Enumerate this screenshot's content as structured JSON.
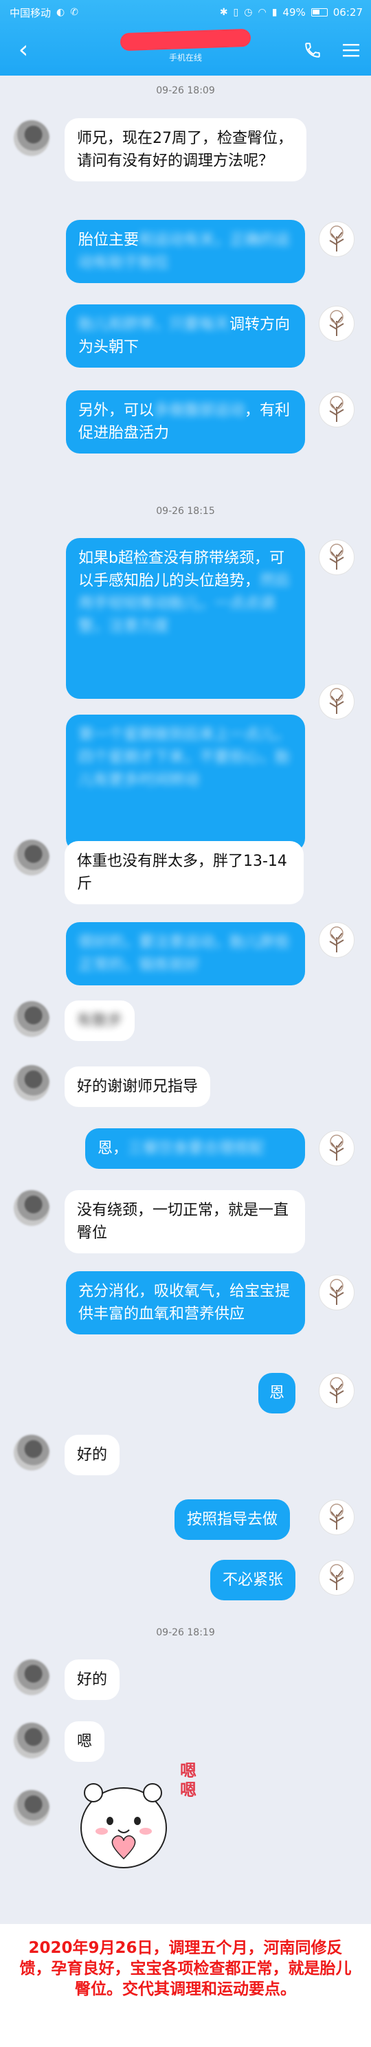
{
  "status_bar": {
    "carrier": "中国移动",
    "battery": "49%",
    "time": "06:27",
    "icons": [
      "bluetooth-icon",
      "vibrate-icon",
      "alarm-icon",
      "wifi-icon",
      "signal-icon",
      "battery-icon"
    ]
  },
  "header": {
    "back_glyph": "‹",
    "subtitle": "手机在线",
    "accent_color": "#1ea7f5"
  },
  "timestamps": [
    "09-26 18:09",
    "09-26 18:15",
    "09-26 18:19"
  ],
  "messages": [
    {
      "side": "left",
      "text": "师兄，现在27周了，检查臀位，请问有没有好的调理方法呢？"
    },
    {
      "side": "right",
      "visible": "胎位主要",
      "blurred": "和运动有关，正确的运动有助于胎位"
    },
    {
      "side": "right",
      "blurred": "胎儿和脐带，只要每天",
      "visible": "调转方向为头朝下"
    },
    {
      "side": "right",
      "visible": "另外，可以",
      "blurred": "多做腹部运动",
      "visible2": "，有利促进胎盘活力"
    },
    {
      "side": "right",
      "visible": "如果b超检查没有脐带绕颈，可以手感知胎儿的头位趋势，",
      "blurred": "然后用手轻轻推动胎儿，一点点调整，注意力度"
    },
    {
      "side": "right",
      "blurred": "第一个星期做到后来上一点儿，四个星期才下来，不要担心，胎儿有更多时间转动"
    },
    {
      "side": "left",
      "text": "体重也没有胖太多，胖了13-14斤"
    },
    {
      "side": "right",
      "blurred": "很好的，要注意运动，胎儿胖些正常的，锻炼就好"
    },
    {
      "side": "left",
      "blurred": "有散步"
    },
    {
      "side": "left",
      "text": "好的谢谢师兄指导"
    },
    {
      "side": "right",
      "visible": "恩，",
      "blurred": "三餐饮食要合理搭配"
    },
    {
      "side": "left",
      "text": "没有绕颈，一切正常，就是一直臀位"
    },
    {
      "side": "right",
      "text": "充分消化，吸收氧气，给宝宝提供丰富的血氧和营养供应"
    },
    {
      "side": "right",
      "text": "恩"
    },
    {
      "side": "left",
      "text": "好的"
    },
    {
      "side": "right",
      "text": "按照指导去做"
    },
    {
      "side": "right",
      "text": "不必紧张"
    },
    {
      "side": "left",
      "text": "好的"
    },
    {
      "side": "left",
      "text": "嗯"
    }
  ],
  "sticker": {
    "caption": "嗯嗯"
  },
  "footer": {
    "text": "2020年9月26日，调理五个月，河南同修反馈，孕育良好，宝宝各项检查都正常，就是胎儿臀位。交代其调理和运动要点。",
    "color": "#ef1a1a"
  }
}
